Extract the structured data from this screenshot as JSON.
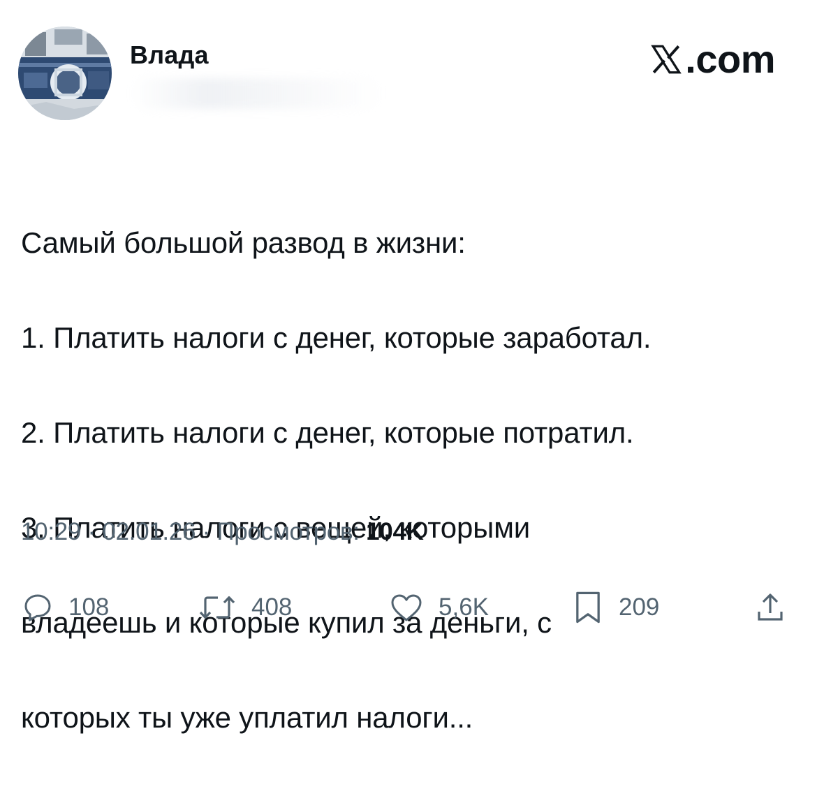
{
  "author": {
    "name": "Влада"
  },
  "brand": {
    "label": ".com",
    "icon": "x-logo-icon"
  },
  "tweet": {
    "lines": [
      "Самый большой развод в жизни:",
      "1. Платить налоги с денег, которые заработал.",
      "2. Платить налоги с денег, которые потратил.",
      "3. Платить налоги с вещей, которыми",
      "владеешь и которые купил за деньги, с",
      "которых ты уже уплатил налоги..."
    ]
  },
  "meta": {
    "time": "10:29",
    "separator": " · ",
    "date": "02.01.26",
    "views_label": "Просмотров: ",
    "views_count": "104K"
  },
  "actions": {
    "reply": {
      "icon": "reply-icon",
      "count": "108"
    },
    "retweet": {
      "icon": "retweet-icon",
      "count": "408"
    },
    "like": {
      "icon": "heart-icon",
      "count": "5,6K"
    },
    "bookmark": {
      "icon": "bookmark-icon",
      "count": "209"
    },
    "share": {
      "icon": "share-icon"
    }
  },
  "colors": {
    "text_primary": "#0f1419",
    "text_secondary": "#536471",
    "background": "#ffffff"
  }
}
